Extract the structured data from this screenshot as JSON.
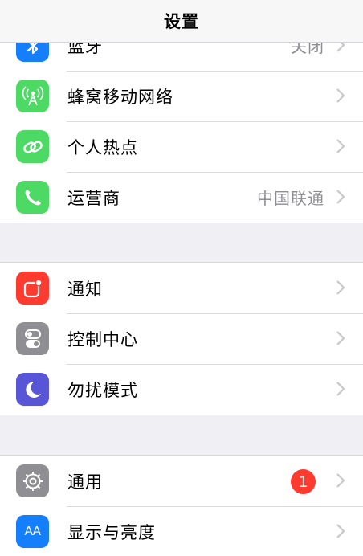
{
  "navbar": {
    "title": "设置"
  },
  "groups": [
    {
      "rows": [
        {
          "label": "蓝牙",
          "value": "关闭",
          "icon": "bluetooth-icon",
          "color": "#147efb"
        },
        {
          "label": "蜂窝移动网络",
          "value": "",
          "icon": "cellular-antenna-icon",
          "color": "#4cd964"
        },
        {
          "label": "个人热点",
          "value": "",
          "icon": "hotspot-link-icon",
          "color": "#4cd964"
        },
        {
          "label": "运营商",
          "value": "中国联通",
          "icon": "phone-icon",
          "color": "#4cd964"
        }
      ]
    },
    {
      "rows": [
        {
          "label": "通知",
          "value": "",
          "icon": "notifications-icon",
          "color": "#ff3b30"
        },
        {
          "label": "控制中心",
          "value": "",
          "icon": "control-center-toggles-icon",
          "color": "#8e8e93"
        },
        {
          "label": "勿扰模式",
          "value": "",
          "icon": "moon-icon",
          "color": "#5856d6"
        }
      ]
    },
    {
      "rows": [
        {
          "label": "通用",
          "value": "",
          "badge": "1",
          "icon": "gear-icon",
          "color": "#8e8e93"
        },
        {
          "label": "显示与亮度",
          "value": "",
          "icon": "display-aa-icon",
          "color": "#147efb"
        }
      ]
    }
  ],
  "display_icon_text": "AA"
}
